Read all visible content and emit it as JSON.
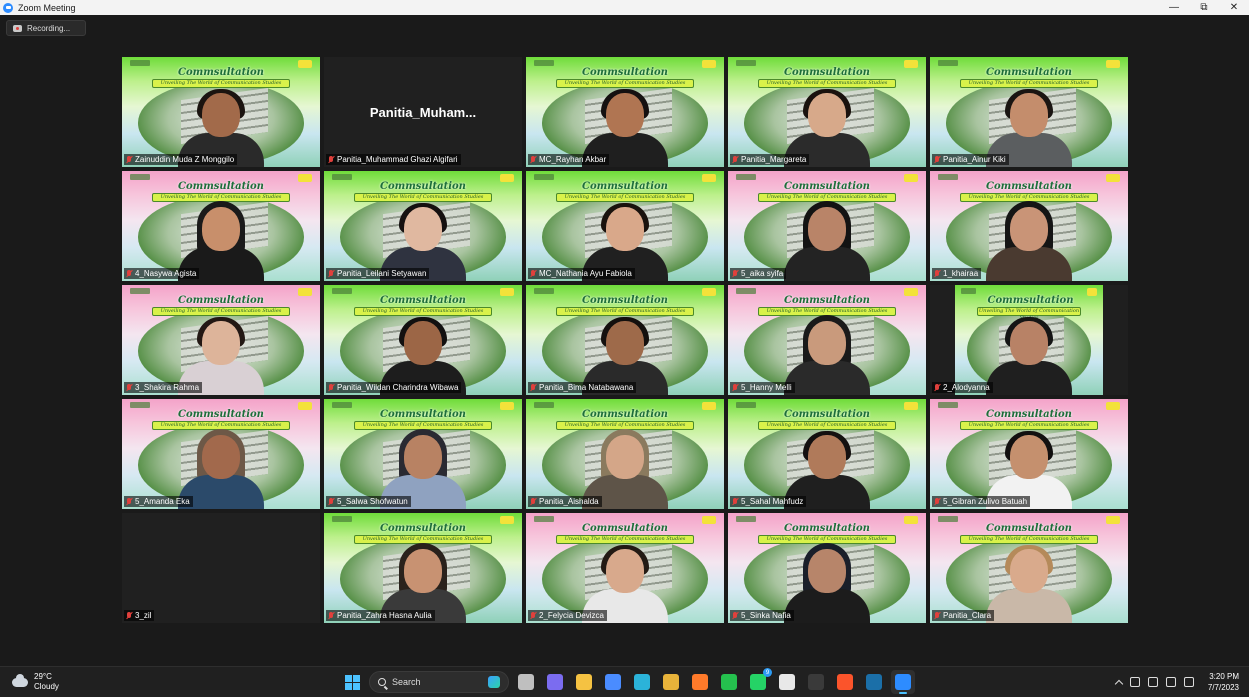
{
  "window": {
    "title": "Zoom Meeting",
    "minimize": "—",
    "maximize": "⧉",
    "close": "✕"
  },
  "recording": {
    "label": "Recording..."
  },
  "banner": {
    "title": "Commsultation",
    "subtitle": "Unveiling The World of Communication Studies"
  },
  "participants": [
    {
      "name": "Zainuddin Muda Z Monggilo",
      "bg": "g",
      "video": true,
      "skin": "#a26a4a",
      "hair": "#1b1410",
      "shirt": "#2a2a2a"
    },
    {
      "name": "Panitia_Muhammad Ghazi Algifari",
      "display": "Panitia_Muham...",
      "bg": "dark",
      "video": false
    },
    {
      "name": "MC_Rayhan Akbar",
      "bg": "g",
      "video": true,
      "skin": "#b07552",
      "hair": "#151010",
      "shirt": "#1f1f1f"
    },
    {
      "name": "Panitia_Margareta",
      "bg": "g",
      "video": true,
      "skin": "#d7a98a",
      "hair": "#1a120e",
      "shirt": "#2b2b2b"
    },
    {
      "name": "Panitia_Ainur Kiki",
      "bg": "g",
      "video": true,
      "skin": "#c48d6c",
      "hair": "#1a1512",
      "shirt": "#5b5e60"
    },
    {
      "name": "4_Nasywa Agista",
      "bg": "p",
      "video": true,
      "skin": "#c88f6b",
      "hair": "#1a1a1a",
      "shirt": "#1a1a1a",
      "hijab": true
    },
    {
      "name": "Panitia_Leilani Setyawan",
      "bg": "g",
      "video": true,
      "skin": "#e0b8a0",
      "hair": "#151010",
      "shirt": "#2f3340"
    },
    {
      "name": "MC_Nathania Ayu Fabiola",
      "bg": "g",
      "video": true,
      "skin": "#d9a88a",
      "hair": "#1a120d",
      "shirt": "#202020",
      "active": true
    },
    {
      "name": "5_aika syifa",
      "bg": "p",
      "video": true,
      "skin": "#b98468",
      "hair": "#131313",
      "shirt": "#232323",
      "hijab": true
    },
    {
      "name": "1_khairaa",
      "bg": "p",
      "video": true,
      "skin": "#c99477",
      "hair": "#151515",
      "shirt": "#4a3a30",
      "hijab": true
    },
    {
      "name": "3_Shakira Rahma",
      "bg": "p",
      "video": true,
      "skin": "#ddb49a",
      "hair": "#231814",
      "shirt": "#d9d0d4"
    },
    {
      "name": "Panitia_Wildan Charindra Wibawa",
      "bg": "g",
      "video": true,
      "skin": "#9c6646",
      "hair": "#121010",
      "shirt": "#1d1d1d"
    },
    {
      "name": "Panitia_Bima Natabawana",
      "bg": "g",
      "video": true,
      "skin": "#9e6a4a",
      "hair": "#14100e",
      "shirt": "#2a2a2a"
    },
    {
      "name": "5_Hanny Melli",
      "bg": "p",
      "video": true,
      "skin": "#c99a7c",
      "hair": "#1a1a1a",
      "shirt": "#2a2a2a",
      "hijab": true
    },
    {
      "name": "2_Alodyanna",
      "bg": "g",
      "video": true,
      "skin": "#b88266",
      "hair": "#151515",
      "shirt": "#1f1f1f",
      "portrait": true
    },
    {
      "name": "5_Amanda Eka",
      "bg": "p",
      "video": true,
      "skin": "#a2694c",
      "hair": "#6d5847",
      "shirt": "#2b4a6a",
      "hijab": true
    },
    {
      "name": "5_Salwa Shofwatun",
      "bg": "g",
      "video": true,
      "skin": "#b88263",
      "hair": "#2a2a32",
      "shirt": "#8fa2c0",
      "hijab": true
    },
    {
      "name": "Panitia_Aishalda",
      "bg": "g",
      "video": true,
      "skin": "#d4a688",
      "hair": "#8a7a5e",
      "shirt": "#5e5448",
      "hijab": true
    },
    {
      "name": "5_Sahal Mahfudz",
      "bg": "g",
      "video": true,
      "skin": "#b07a5a",
      "hair": "#141010",
      "shirt": "#1f1f1f"
    },
    {
      "name": "5_Gibran Zulivo Batuah",
      "bg": "p",
      "video": true,
      "skin": "#c5906e",
      "hair": "#121010",
      "shirt": "#f2f2f2"
    },
    {
      "name": "3_zil",
      "bg": "dark",
      "video": false
    },
    {
      "name": "Panitia_Zahra Hasna Aulia",
      "bg": "g",
      "video": true,
      "skin": "#c89272",
      "hair": "#2a221c",
      "shirt": "#3a3a3a",
      "hijab": true
    },
    {
      "name": "2_Felycia Devizca",
      "bg": "p",
      "video": true,
      "skin": "#d8a98c",
      "hair": "#231a14",
      "shirt": "#e8e8e8"
    },
    {
      "name": "5_Sinka Nafia",
      "bg": "p",
      "video": true,
      "skin": "#b7856a",
      "hair": "#1a1f2a",
      "shirt": "#1c1c1c",
      "hijab": true
    },
    {
      "name": "Panitia_Clara",
      "bg": "p",
      "video": true,
      "skin": "#d9aa8c",
      "hair": "#b58a5a",
      "shirt": "#c9b8a8"
    }
  ],
  "taskbar": {
    "weather": {
      "temp": "29°C",
      "condition": "Cloudy"
    },
    "search_placeholder": "Search",
    "apps": [
      {
        "name": "task-view",
        "color": "#bfbfbf"
      },
      {
        "name": "teams-chat",
        "color": "#7b6cf0"
      },
      {
        "name": "file-explorer",
        "color": "#f5c242"
      },
      {
        "name": "microsoft-store",
        "color": "#4a8cff"
      },
      {
        "name": "edge",
        "color": "#2bb3d9"
      },
      {
        "name": "chrome",
        "color": "#e8b33a"
      },
      {
        "name": "firefox",
        "color": "#ff7a2a"
      },
      {
        "name": "line",
        "color": "#25c14e"
      },
      {
        "name": "whatsapp",
        "color": "#25d366",
        "badge": "9"
      },
      {
        "name": "notion",
        "color": "#e8e8e8"
      },
      {
        "name": "capcut",
        "color": "#3a3a3a"
      },
      {
        "name": "brave",
        "color": "#fb542b"
      },
      {
        "name": "steam",
        "color": "#1b6fa8"
      },
      {
        "name": "zoom",
        "color": "#2d8cff",
        "active": true
      }
    ],
    "time": "3:20 PM",
    "date": "7/7/2023"
  }
}
